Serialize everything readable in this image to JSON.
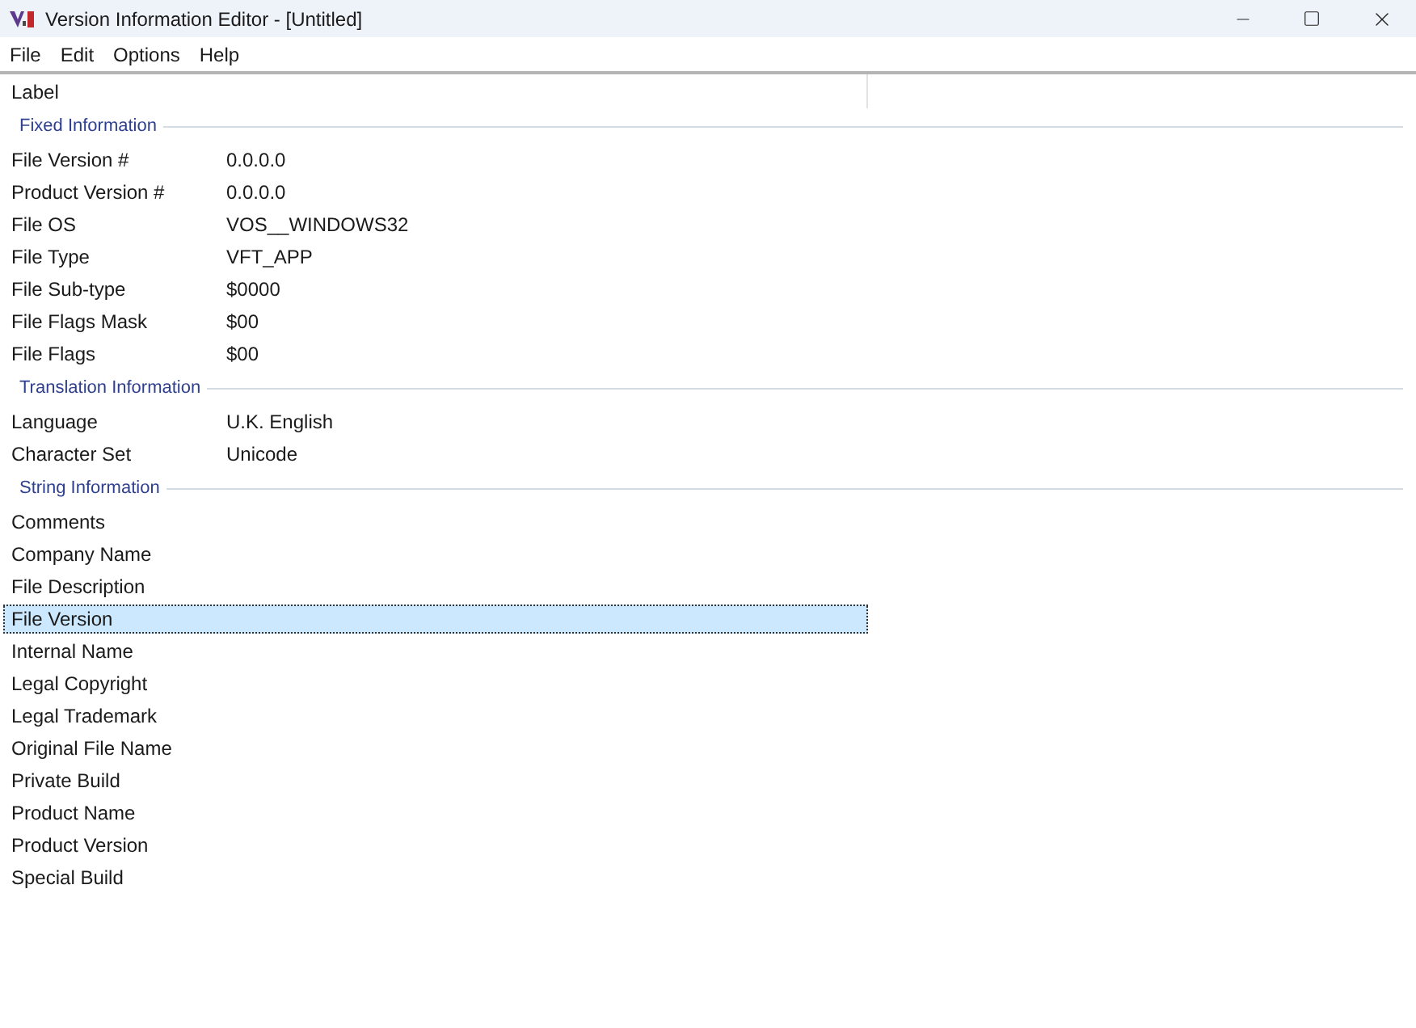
{
  "window": {
    "title": "Version Information Editor - [Untitled]"
  },
  "menu": [
    "File",
    "Edit",
    "Options",
    "Help"
  ],
  "columns": [
    {
      "label": "Label"
    }
  ],
  "sections": [
    {
      "title": "Fixed Information",
      "rows": [
        {
          "label": "File Version #",
          "value": "0.0.0.0",
          "selected": false
        },
        {
          "label": "Product Version #",
          "value": "0.0.0.0",
          "selected": false
        },
        {
          "label": "File OS",
          "value": "VOS__WINDOWS32",
          "selected": false
        },
        {
          "label": "File Type",
          "value": "VFT_APP",
          "selected": false
        },
        {
          "label": "File Sub-type",
          "value": "$0000",
          "selected": false
        },
        {
          "label": "File Flags Mask",
          "value": "$00",
          "selected": false
        },
        {
          "label": "File Flags",
          "value": "$00",
          "selected": false
        }
      ]
    },
    {
      "title": "Translation Information",
      "rows": [
        {
          "label": "Language",
          "value": "U.K. English",
          "selected": false
        },
        {
          "label": "Character Set",
          "value": "Unicode",
          "selected": false
        }
      ]
    },
    {
      "title": "String Information",
      "rows": [
        {
          "label": "Comments",
          "selected": false
        },
        {
          "label": "Company Name",
          "selected": false
        },
        {
          "label": "File Description",
          "selected": false
        },
        {
          "label": "File Version",
          "selected": true
        },
        {
          "label": "Internal Name",
          "selected": false
        },
        {
          "label": "Legal Copyright",
          "selected": false
        },
        {
          "label": "Legal Trademark",
          "selected": false
        },
        {
          "label": "Original File Name",
          "selected": false
        },
        {
          "label": "Private Build",
          "selected": false
        },
        {
          "label": "Product Name",
          "selected": false
        },
        {
          "label": "Product Version",
          "selected": false
        },
        {
          "label": "Special Build",
          "selected": false
        }
      ]
    }
  ]
}
